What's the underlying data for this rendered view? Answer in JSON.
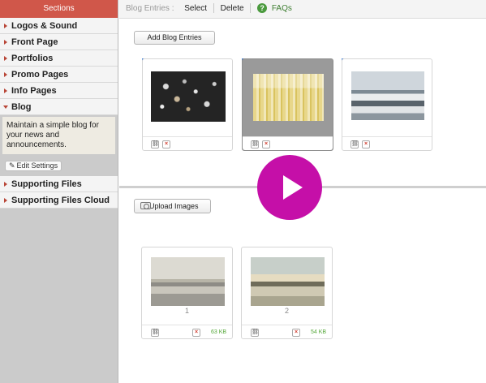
{
  "sidebar": {
    "header": "Sections",
    "items": [
      {
        "label": "Logos & Sound"
      },
      {
        "label": "Front Page"
      },
      {
        "label": "Portfolios"
      },
      {
        "label": "Promo Pages"
      },
      {
        "label": "Info Pages"
      },
      {
        "label": "Blog"
      },
      {
        "label": "Supporting Files"
      },
      {
        "label": "Supporting Files Cloud"
      }
    ],
    "blog_description": "Maintain a simple blog for your news and announcements.",
    "edit_settings_label": "Edit Settings"
  },
  "topbar": {
    "context_label": "Blog Entries :",
    "select_label": "Select",
    "delete_label": "Delete",
    "faqs_label": "FAQs"
  },
  "blog": {
    "add_button_label": "Add Blog Entries",
    "entries": [
      {
        "thumb": "dark-beach-stones-photo",
        "selected": false
      },
      {
        "thumb": "yellow-abstract-photo",
        "selected": true
      },
      {
        "thumb": "snowy-rocky-coast-photo",
        "selected": false
      }
    ]
  },
  "images": {
    "upload_button_label": "Upload Images",
    "items": [
      {
        "number": "1",
        "size": "63 KB",
        "thumb": "beach-dusk-photo"
      },
      {
        "number": "2",
        "size": "54 KB",
        "thumb": "coast-sunset-photo"
      }
    ]
  },
  "icons": {
    "link": "link-icon",
    "delete": "delete-icon",
    "help": "help-icon",
    "camera": "camera-icon",
    "play": "play-icon"
  },
  "colors": {
    "sidebar_header": "#d0574a",
    "arrow": "#b84536",
    "help_green": "#4b9a3e",
    "play_magenta": "#c50fa8",
    "selected_card": "#9a9a9a",
    "size_green": "#55a83a"
  }
}
